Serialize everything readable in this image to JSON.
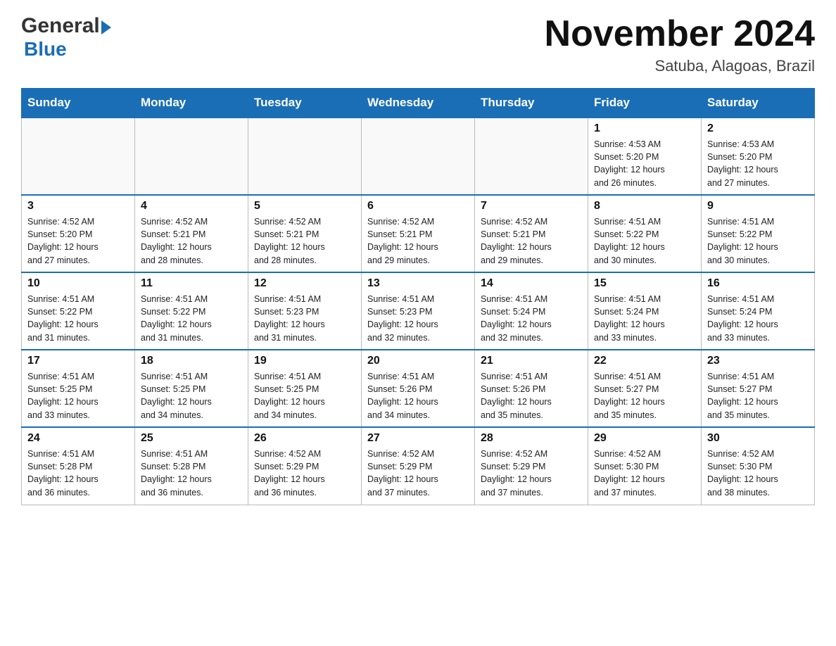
{
  "header": {
    "month_title": "November 2024",
    "location": "Satuba, Alagoas, Brazil",
    "logo_general": "General",
    "logo_blue": "Blue"
  },
  "days_of_week": [
    "Sunday",
    "Monday",
    "Tuesday",
    "Wednesday",
    "Thursday",
    "Friday",
    "Saturday"
  ],
  "weeks": [
    {
      "days": [
        {
          "number": "",
          "info": ""
        },
        {
          "number": "",
          "info": ""
        },
        {
          "number": "",
          "info": ""
        },
        {
          "number": "",
          "info": ""
        },
        {
          "number": "",
          "info": ""
        },
        {
          "number": "1",
          "info": "Sunrise: 4:53 AM\nSunset: 5:20 PM\nDaylight: 12 hours\nand 26 minutes."
        },
        {
          "number": "2",
          "info": "Sunrise: 4:53 AM\nSunset: 5:20 PM\nDaylight: 12 hours\nand 27 minutes."
        }
      ]
    },
    {
      "days": [
        {
          "number": "3",
          "info": "Sunrise: 4:52 AM\nSunset: 5:20 PM\nDaylight: 12 hours\nand 27 minutes."
        },
        {
          "number": "4",
          "info": "Sunrise: 4:52 AM\nSunset: 5:21 PM\nDaylight: 12 hours\nand 28 minutes."
        },
        {
          "number": "5",
          "info": "Sunrise: 4:52 AM\nSunset: 5:21 PM\nDaylight: 12 hours\nand 28 minutes."
        },
        {
          "number": "6",
          "info": "Sunrise: 4:52 AM\nSunset: 5:21 PM\nDaylight: 12 hours\nand 29 minutes."
        },
        {
          "number": "7",
          "info": "Sunrise: 4:52 AM\nSunset: 5:21 PM\nDaylight: 12 hours\nand 29 minutes."
        },
        {
          "number": "8",
          "info": "Sunrise: 4:51 AM\nSunset: 5:22 PM\nDaylight: 12 hours\nand 30 minutes."
        },
        {
          "number": "9",
          "info": "Sunrise: 4:51 AM\nSunset: 5:22 PM\nDaylight: 12 hours\nand 30 minutes."
        }
      ]
    },
    {
      "days": [
        {
          "number": "10",
          "info": "Sunrise: 4:51 AM\nSunset: 5:22 PM\nDaylight: 12 hours\nand 31 minutes."
        },
        {
          "number": "11",
          "info": "Sunrise: 4:51 AM\nSunset: 5:22 PM\nDaylight: 12 hours\nand 31 minutes."
        },
        {
          "number": "12",
          "info": "Sunrise: 4:51 AM\nSunset: 5:23 PM\nDaylight: 12 hours\nand 31 minutes."
        },
        {
          "number": "13",
          "info": "Sunrise: 4:51 AM\nSunset: 5:23 PM\nDaylight: 12 hours\nand 32 minutes."
        },
        {
          "number": "14",
          "info": "Sunrise: 4:51 AM\nSunset: 5:24 PM\nDaylight: 12 hours\nand 32 minutes."
        },
        {
          "number": "15",
          "info": "Sunrise: 4:51 AM\nSunset: 5:24 PM\nDaylight: 12 hours\nand 33 minutes."
        },
        {
          "number": "16",
          "info": "Sunrise: 4:51 AM\nSunset: 5:24 PM\nDaylight: 12 hours\nand 33 minutes."
        }
      ]
    },
    {
      "days": [
        {
          "number": "17",
          "info": "Sunrise: 4:51 AM\nSunset: 5:25 PM\nDaylight: 12 hours\nand 33 minutes."
        },
        {
          "number": "18",
          "info": "Sunrise: 4:51 AM\nSunset: 5:25 PM\nDaylight: 12 hours\nand 34 minutes."
        },
        {
          "number": "19",
          "info": "Sunrise: 4:51 AM\nSunset: 5:25 PM\nDaylight: 12 hours\nand 34 minutes."
        },
        {
          "number": "20",
          "info": "Sunrise: 4:51 AM\nSunset: 5:26 PM\nDaylight: 12 hours\nand 34 minutes."
        },
        {
          "number": "21",
          "info": "Sunrise: 4:51 AM\nSunset: 5:26 PM\nDaylight: 12 hours\nand 35 minutes."
        },
        {
          "number": "22",
          "info": "Sunrise: 4:51 AM\nSunset: 5:27 PM\nDaylight: 12 hours\nand 35 minutes."
        },
        {
          "number": "23",
          "info": "Sunrise: 4:51 AM\nSunset: 5:27 PM\nDaylight: 12 hours\nand 35 minutes."
        }
      ]
    },
    {
      "days": [
        {
          "number": "24",
          "info": "Sunrise: 4:51 AM\nSunset: 5:28 PM\nDaylight: 12 hours\nand 36 minutes."
        },
        {
          "number": "25",
          "info": "Sunrise: 4:51 AM\nSunset: 5:28 PM\nDaylight: 12 hours\nand 36 minutes."
        },
        {
          "number": "26",
          "info": "Sunrise: 4:52 AM\nSunset: 5:29 PM\nDaylight: 12 hours\nand 36 minutes."
        },
        {
          "number": "27",
          "info": "Sunrise: 4:52 AM\nSunset: 5:29 PM\nDaylight: 12 hours\nand 37 minutes."
        },
        {
          "number": "28",
          "info": "Sunrise: 4:52 AM\nSunset: 5:29 PM\nDaylight: 12 hours\nand 37 minutes."
        },
        {
          "number": "29",
          "info": "Sunrise: 4:52 AM\nSunset: 5:30 PM\nDaylight: 12 hours\nand 37 minutes."
        },
        {
          "number": "30",
          "info": "Sunrise: 4:52 AM\nSunset: 5:30 PM\nDaylight: 12 hours\nand 38 minutes."
        }
      ]
    }
  ]
}
